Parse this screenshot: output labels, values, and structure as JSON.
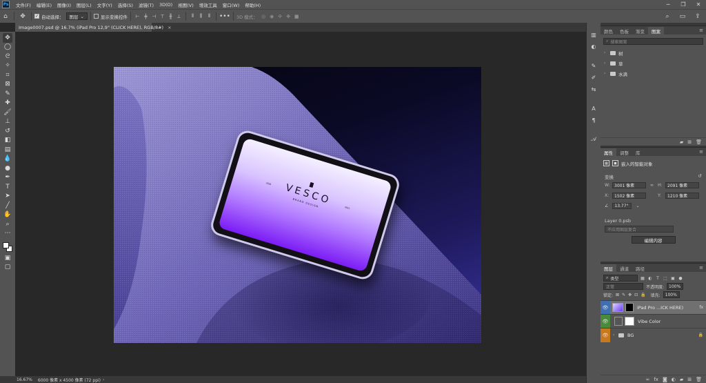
{
  "menubar": {
    "app_icon": "Ps",
    "items": [
      "文件(F)",
      "编辑(E)",
      "图像(I)",
      "图层(L)",
      "文字(Y)",
      "选择(S)",
      "滤镜(T)",
      "3D(D)",
      "视图(V)",
      "增效工具",
      "窗口(W)",
      "帮助(H)"
    ],
    "window_controls": [
      "─",
      "❐",
      "✕"
    ]
  },
  "options": {
    "auto_select_label": "自动选择：",
    "auto_select_value": "图层",
    "show_transform_label": "显示变换控件",
    "mode_label": "3D 模式："
  },
  "document_tab": {
    "title": "Image0007.psd @ 16.7% (iPad Pro 12,9\" (CLICK HERE), RGB/8#)",
    "close": "×"
  },
  "canvas": {
    "brand": "VESCO",
    "brand_sub": "BRAND DESIGN",
    "brand_left": "2020",
    "brand_right": "2021"
  },
  "status": {
    "zoom": "16.67%",
    "doc_info": "6000 像素 x 4500 像素 (72 ppi)",
    "arrow": "›"
  },
  "libraries_panel": {
    "tabs": [
      "颜色",
      "色板",
      "渐变",
      "图案"
    ],
    "active_tab": 3,
    "search_placeholder": "搜索图案",
    "folders": [
      "树",
      "草",
      "水滴"
    ]
  },
  "properties_panel": {
    "tabs": [
      "属性",
      "调整",
      "库"
    ],
    "active_tab": 0,
    "object_type": "嵌入的智能对象",
    "transform_label": "变换",
    "w_label": "W:",
    "w_value": "3001 像素",
    "h_label": "H:",
    "h_value": "2091 像素",
    "x_label": "X:",
    "x_value": "1502 像素",
    "y_label": "Y:",
    "y_value": "1210 像素",
    "angle_value": "13.77°",
    "file_name": "Layer 0.psb",
    "comp_placeholder": "不应用图层复合",
    "edit_button": "编辑内容"
  },
  "layers_panel": {
    "tabs": [
      "图层",
      "通道",
      "路径"
    ],
    "active_tab": 0,
    "filter_label": "类型",
    "blend_mode": "正常",
    "opacity_label": "不透明度:",
    "opacity_value": "100%",
    "lock_label": "锁定:",
    "fill_label": "填充:",
    "fill_value": "100%",
    "layers": [
      {
        "name": "iPad Pro ...ICK HERE)",
        "fx": "fx",
        "eye_color": "#3f6fb0"
      },
      {
        "name": "Vibe Color",
        "eye_color": "#4a8a3c"
      },
      {
        "name": "BG",
        "eye_color": "#c9781e"
      }
    ]
  }
}
